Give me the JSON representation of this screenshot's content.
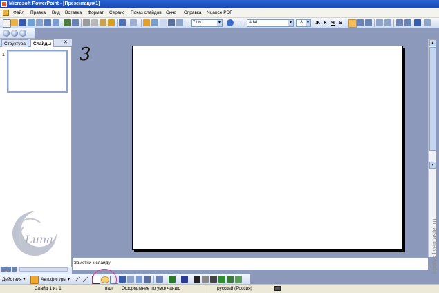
{
  "window": {
    "title": "Microsoft PowerPoint - [Презентация1]"
  },
  "menu": {
    "items": [
      "Файл",
      "Правка",
      "Вид",
      "Вставка",
      "Формат",
      "Сервис",
      "Показ слайдов",
      "Окно",
      "Справка",
      "Nuance PDF"
    ]
  },
  "toolbar": {
    "zoom": "71%",
    "font_name": "Arial",
    "font_size": "18",
    "bold": "Ж",
    "italic": "К",
    "underline": "Ч",
    "shadow": "S"
  },
  "panel": {
    "tabs": [
      "Структура",
      "Слайды"
    ],
    "close": "✕",
    "thumb_number": "1"
  },
  "slide": {
    "handwritten_number": "3"
  },
  "notes": {
    "placeholder": "Заметки к слайду"
  },
  "drawing": {
    "actions_label": "Действия",
    "autoshapes_label": "Автофигуры"
  },
  "status": {
    "slide_info": "Слайд 1 из 1",
    "design": "Оформление по умолчанию",
    "language": "русский (Россия)",
    "tooltip_fragment": "вал"
  },
  "watermark": {
    "text": "i-polyk.livemaster.ru"
  },
  "logo": {
    "text": "Luna"
  },
  "colors": {
    "titlebar": "#1c4fc0",
    "workspace": "#8d99bb",
    "highlight": "#e0307a"
  }
}
